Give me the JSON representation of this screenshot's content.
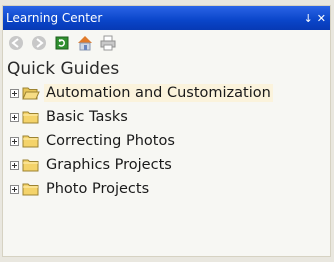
{
  "window": {
    "title": "Learning Center",
    "pin_glyph": "↓",
    "close_glyph": "✕"
  },
  "toolbar": {
    "buttons": [
      {
        "icon": "back-arrow-icon"
      },
      {
        "icon": "forward-arrow-icon"
      },
      {
        "icon": "refresh-icon"
      },
      {
        "icon": "home-icon"
      },
      {
        "icon": "print-icon"
      }
    ]
  },
  "section": {
    "heading": "Quick Guides"
  },
  "tree": {
    "items": [
      {
        "label": "Automation and Customization",
        "icon": "folder-open-icon",
        "selected": true
      },
      {
        "label": "Basic Tasks",
        "icon": "folder-icon"
      },
      {
        "label": "Correcting Photos",
        "icon": "folder-icon"
      },
      {
        "label": "Graphics Projects",
        "icon": "folder-icon"
      },
      {
        "label": "Photo Projects",
        "icon": "folder-icon"
      }
    ]
  },
  "colors": {
    "titlebar": "#0a45c9",
    "panel": "#f7f7f3",
    "selection": "#fbf3dc",
    "folder": "#f4d36a"
  }
}
